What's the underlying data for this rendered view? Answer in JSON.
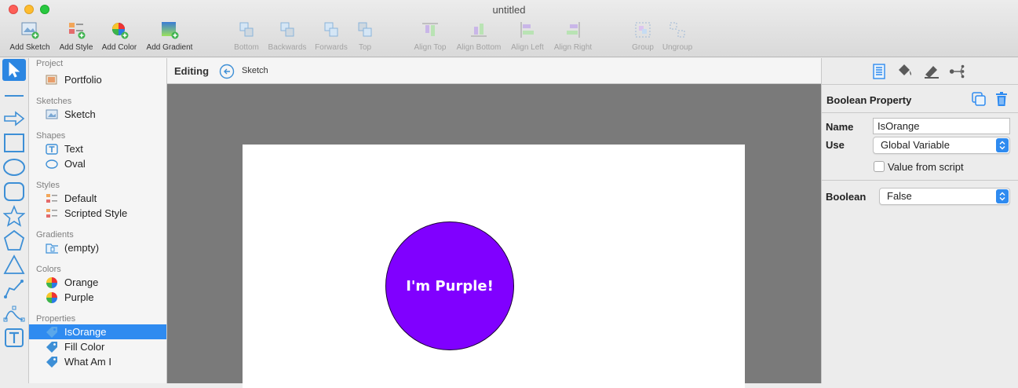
{
  "window": {
    "title": "untitled"
  },
  "toolbar": {
    "add_sketch": "Add Sketch",
    "add_style": "Add Style",
    "add_color": "Add Color",
    "add_gradient": "Add Gradient",
    "bottom": "Bottom",
    "backwards": "Backwards",
    "forwards": "Forwards",
    "top": "Top",
    "align_top": "Align Top",
    "align_bottom": "Align Bottom",
    "align_left": "Align Left",
    "align_right": "Align Right",
    "group": "Group",
    "ungroup": "Ungroup"
  },
  "sidebar": {
    "project_header": "Project",
    "project_item": "Portfolio",
    "sketches_header": "Sketches",
    "sketch_item": "Sketch",
    "shapes_header": "Shapes",
    "shape_text": "Text",
    "shape_oval": "Oval",
    "styles_header": "Styles",
    "style_default": "Default",
    "style_scripted": "Scripted Style",
    "gradients_header": "Gradients",
    "gradient_empty": "(empty)",
    "colors_header": "Colors",
    "color_orange": "Orange",
    "color_purple": "Purple",
    "properties_header": "Properties",
    "prop_isorange": "IsOrange",
    "prop_fillcolor": "Fill Color",
    "prop_whatami": "What Am I"
  },
  "editor": {
    "editing_label": "Editing",
    "sketch_name": "Sketch",
    "circle_text": "I'm Purple!",
    "circle_color": "#8000ff"
  },
  "inspector": {
    "title": "Boolean Property",
    "name_label": "Name",
    "name_value": "IsOrange",
    "use_label": "Use",
    "use_value": "Global Variable",
    "value_from_script": "Value from script",
    "value_from_script_checked": false,
    "boolean_label": "Boolean",
    "boolean_value": "False"
  },
  "colors": {
    "accent": "#2f8bf0",
    "icon_blue": "#3d8fd6"
  }
}
